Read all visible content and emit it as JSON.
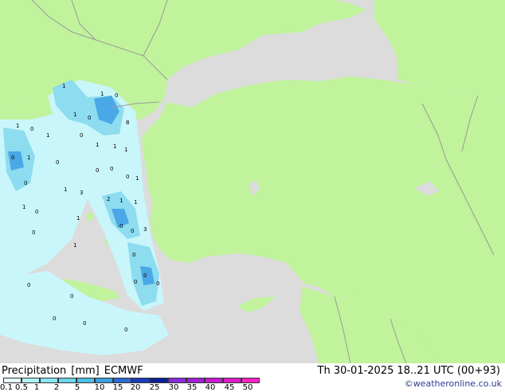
{
  "title": {
    "product": "Precipitation",
    "unit": "[mm]",
    "model": "ECMWF",
    "valid_time": "Th 30-01-2025 18..21 UTC (00+93)"
  },
  "credit": "©weatheronline.co.uk",
  "legend": {
    "labels": [
      "0.1",
      "0.5",
      "1",
      "2",
      "5",
      "10",
      "15",
      "20",
      "25",
      "30",
      "35",
      "40",
      "45",
      "50"
    ],
    "colors": [
      "#e4fdff",
      "#aff3f9",
      "#87e7f2",
      "#6ad6ec",
      "#4cbfe7",
      "#3a9fdf",
      "#2c6ad4",
      "#1b3bbd",
      "#0a1f96",
      "#8a2ae0",
      "#a21fd4",
      "#c91ad4",
      "#e01ccb",
      "#ff22c2"
    ]
  },
  "colors": {
    "sea": "#dcdcdc",
    "land": "#c0f39c",
    "border": "#9a9a9a",
    "rain_light": "#c9f6fb",
    "rain_mid": "#8ddcef",
    "rain_heavy": "#4aa8e6"
  },
  "map_labels": [
    "1",
    "1",
    "0",
    "1",
    "0",
    "8",
    "1",
    "0",
    "1",
    "0",
    "1",
    "1",
    "1",
    "0",
    "1",
    "0",
    "0",
    "0",
    "0",
    "1",
    "0",
    "2",
    "1",
    "1",
    "1",
    "3",
    "0",
    "3",
    "0",
    "1",
    "0",
    "1",
    "1",
    "0",
    "0",
    "0",
    "0",
    "0",
    "0",
    "0",
    "0",
    "0",
    "0"
  ]
}
